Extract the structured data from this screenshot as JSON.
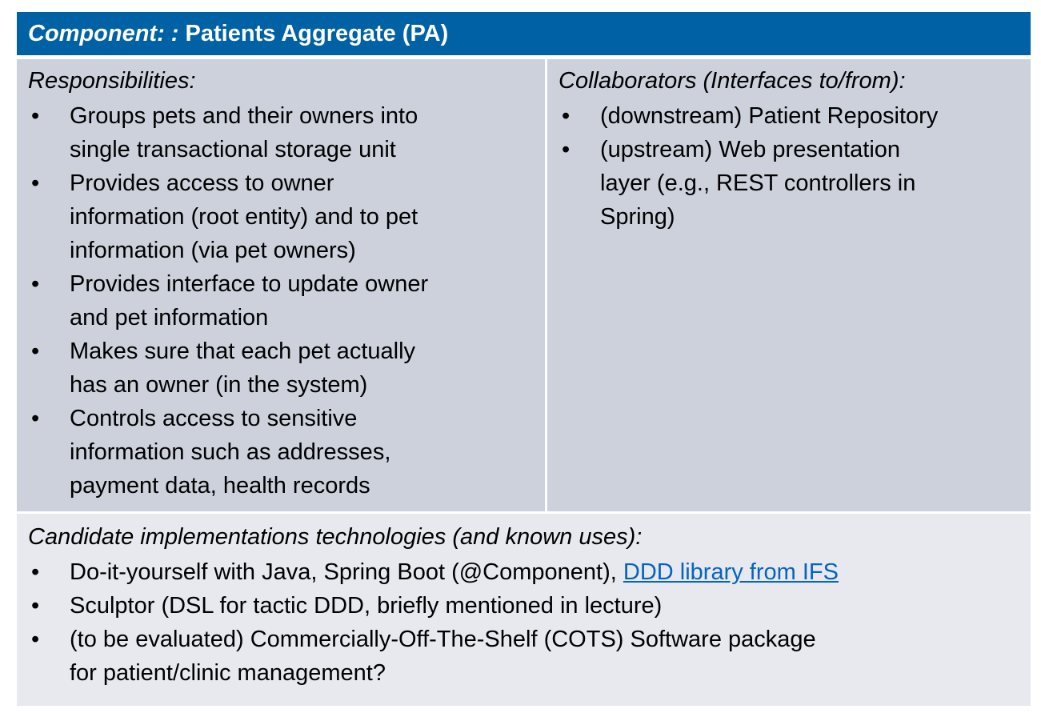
{
  "header": {
    "label_italic": "Component: :",
    "title": "Patients Aggregate (PA)"
  },
  "responsibilities": {
    "title": "Responsibilities:",
    "items": [
      [
        "Groups pets and their owners into",
        "single transactional storage unit"
      ],
      [
        "Provides access to owner",
        "information (root entity) and to pet",
        "information (via pet owners)"
      ],
      [
        "Provides interface to update owner",
        "and pet information"
      ],
      [
        "Makes sure that each pet actually",
        "has an owner (in the system)"
      ],
      [
        "Controls access to sensitive",
        "information such as addresses,",
        "payment data, health records"
      ]
    ]
  },
  "collaborators": {
    "title": "Collaborators (Interfaces to/from):",
    "items": [
      [
        "(downstream) Patient Repository"
      ],
      [
        "(upstream) Web presentation",
        "layer (e.g., REST controllers in",
        "Spring)"
      ]
    ]
  },
  "candidates": {
    "title": "Candidate implementations technologies (and known uses):",
    "item1_text": "Do-it-yourself with Java, Spring Boot (@Component), ",
    "item1_link": "DDD library from IFS",
    "item2": "Sculptor (DSL for tactic DDD, briefly mentioned in lecture)",
    "item3_lines": [
      "(to be evaluated) Commercially-Off-The-Shelf (COTS) Software package",
      "for patient/clinic management?"
    ]
  },
  "bullet_char": "•",
  "colors": {
    "header_bg": "#0061a4",
    "top_cells_bg": "#ccd1dc",
    "bottom_cell_bg": "#e7e9ef",
    "link": "#0563c1"
  }
}
